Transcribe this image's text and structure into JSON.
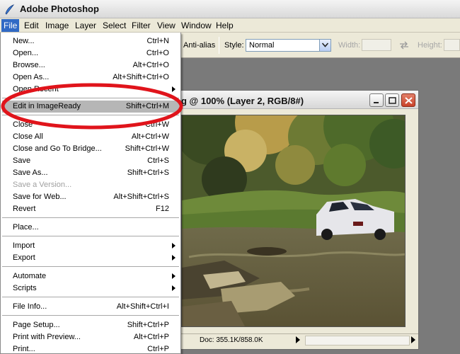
{
  "app": {
    "title": "Adobe Photoshop"
  },
  "menubar": [
    "File",
    "Edit",
    "Image",
    "Layer",
    "Select",
    "Filter",
    "View",
    "Window",
    "Help"
  ],
  "options": {
    "antialias": "Anti-alias",
    "style_label": "Style:",
    "style_value": "Normal",
    "width_label": "Width:",
    "height_label": "Height:"
  },
  "document": {
    "title": "g @ 100% (Layer 2, RGB/8#)",
    "status": "Doc: 355.1K/858.0K"
  },
  "file_menu": [
    {
      "label": "New...",
      "shortcut": "Ctrl+N"
    },
    {
      "label": "Open...",
      "shortcut": "Ctrl+O"
    },
    {
      "label": "Browse...",
      "shortcut": "Alt+Ctrl+O"
    },
    {
      "label": "Open As...",
      "shortcut": "Alt+Shift+Ctrl+O"
    },
    {
      "label": "Open Recent",
      "shortcut": ""
    },
    {
      "label": "Edit in ImageReady",
      "shortcut": "Shift+Ctrl+M"
    },
    {
      "label": "Close",
      "shortcut": "Ctrl+W"
    },
    {
      "label": "Close All",
      "shortcut": "Alt+Ctrl+W"
    },
    {
      "label": "Close and Go To Bridge...",
      "shortcut": "Shift+Ctrl+W"
    },
    {
      "label": "Save",
      "shortcut": "Ctrl+S"
    },
    {
      "label": "Save As...",
      "shortcut": "Shift+Ctrl+S"
    },
    {
      "label": "Save a Version...",
      "shortcut": ""
    },
    {
      "label": "Save for Web...",
      "shortcut": "Alt+Shift+Ctrl+S"
    },
    {
      "label": "Revert",
      "shortcut": "F12"
    },
    {
      "label": "Place...",
      "shortcut": ""
    },
    {
      "label": "Import",
      "shortcut": ""
    },
    {
      "label": "Export",
      "shortcut": ""
    },
    {
      "label": "Automate",
      "shortcut": ""
    },
    {
      "label": "Scripts",
      "shortcut": ""
    },
    {
      "label": "File Info...",
      "shortcut": "Alt+Shift+Ctrl+I"
    },
    {
      "label": "Page Setup...",
      "shortcut": "Shift+Ctrl+P"
    },
    {
      "label": "Print with Preview...",
      "shortcut": "Alt+Ctrl+P"
    },
    {
      "label": "Print...",
      "shortcut": "Ctrl+P"
    }
  ],
  "colors": {
    "highlight": "#b6b6b6",
    "annotation": "#e0141b",
    "menu_active": "#316ac5"
  }
}
